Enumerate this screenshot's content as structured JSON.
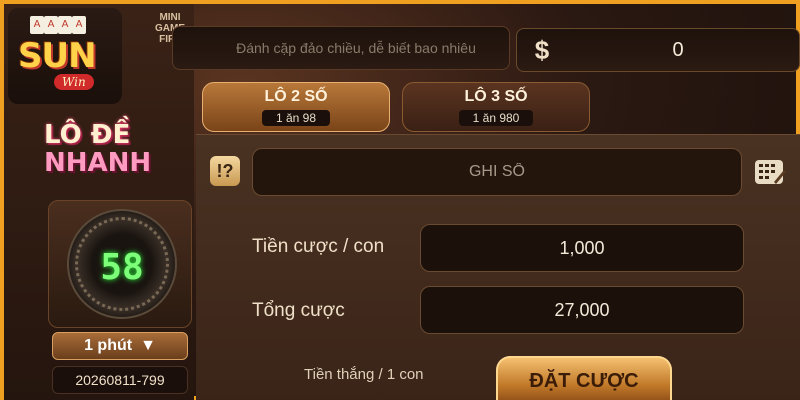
{
  "brand": {
    "name": "SUN",
    "tagline": "Win",
    "card_glyphs": [
      "A",
      "A",
      "A",
      "A"
    ]
  },
  "game": {
    "title_line1": "LÔ ĐỀ",
    "title_line2": "NHANH",
    "mini_game_tag": "MINI GAME FIFA"
  },
  "hint": {
    "text": "Đánh cặp đảo chiều, dễ biết bao nhiêu"
  },
  "balance": {
    "currency_symbol": "$",
    "value": "0"
  },
  "tabs": [
    {
      "label": "LÔ 2 SỐ",
      "odds": "1 ăn 98",
      "active": true
    },
    {
      "label": "LÔ 3 SỐ",
      "odds": "1 ăn 980",
      "active": false
    }
  ],
  "timer": {
    "seconds": "58",
    "interval": "1 phút",
    "interval_arrow": "▼",
    "round_id": "20260811-799"
  },
  "bet_form": {
    "help_symbol": "!?",
    "number_placeholder": "GHI SỐ",
    "stake_label": "Tiền cược / con",
    "stake_value": "1,000",
    "total_label": "Tổng cược",
    "total_value": "27,000",
    "win_label": "Tiền thắng / 1 con",
    "submit_label": "ĐẶT CƯỢC"
  },
  "colors": {
    "accent": "#f0a020",
    "timer_green": "#7dff7a",
    "button_gold": "#f4c070"
  }
}
